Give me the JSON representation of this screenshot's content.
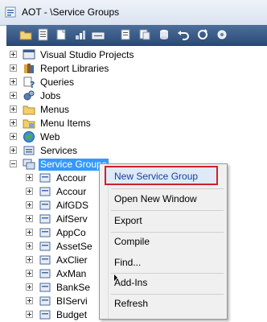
{
  "window": {
    "title": "AOT - \\Service Groups"
  },
  "toolbar": {
    "buttons": [
      "open-icon",
      "properties-icon",
      "new-icon",
      "save-icon",
      "compile-icon",
      "import-icon",
      "export-icon",
      "database-icon",
      "undo-icon",
      "refresh-icon",
      "settings-icon"
    ]
  },
  "tree": {
    "items": [
      {
        "label": "Visual Studio Projects",
        "icon": "vs-projects-icon"
      },
      {
        "label": "Report Libraries",
        "icon": "report-libraries-icon"
      },
      {
        "label": "Queries",
        "icon": "queries-icon"
      },
      {
        "label": "Jobs",
        "icon": "jobs-icon"
      },
      {
        "label": "Menus",
        "icon": "menus-icon"
      },
      {
        "label": "Menu Items",
        "icon": "menu-items-icon"
      },
      {
        "label": "Web",
        "icon": "web-globe-icon"
      },
      {
        "label": "Services",
        "icon": "services-icon"
      },
      {
        "label": "Service Groups",
        "icon": "service-groups-icon"
      }
    ],
    "children": [
      "Accour",
      "Accour",
      "AifGDS",
      "AifServ",
      "AppCo",
      "AssetSe",
      "AxClier",
      "AxMan",
      "BankSe",
      "BIServi",
      "Budget"
    ]
  },
  "context_menu": {
    "items": [
      "New Service Group",
      "Open New Window",
      "Export",
      "Compile",
      "Find...",
      "Add-Ins",
      "Refresh"
    ]
  }
}
